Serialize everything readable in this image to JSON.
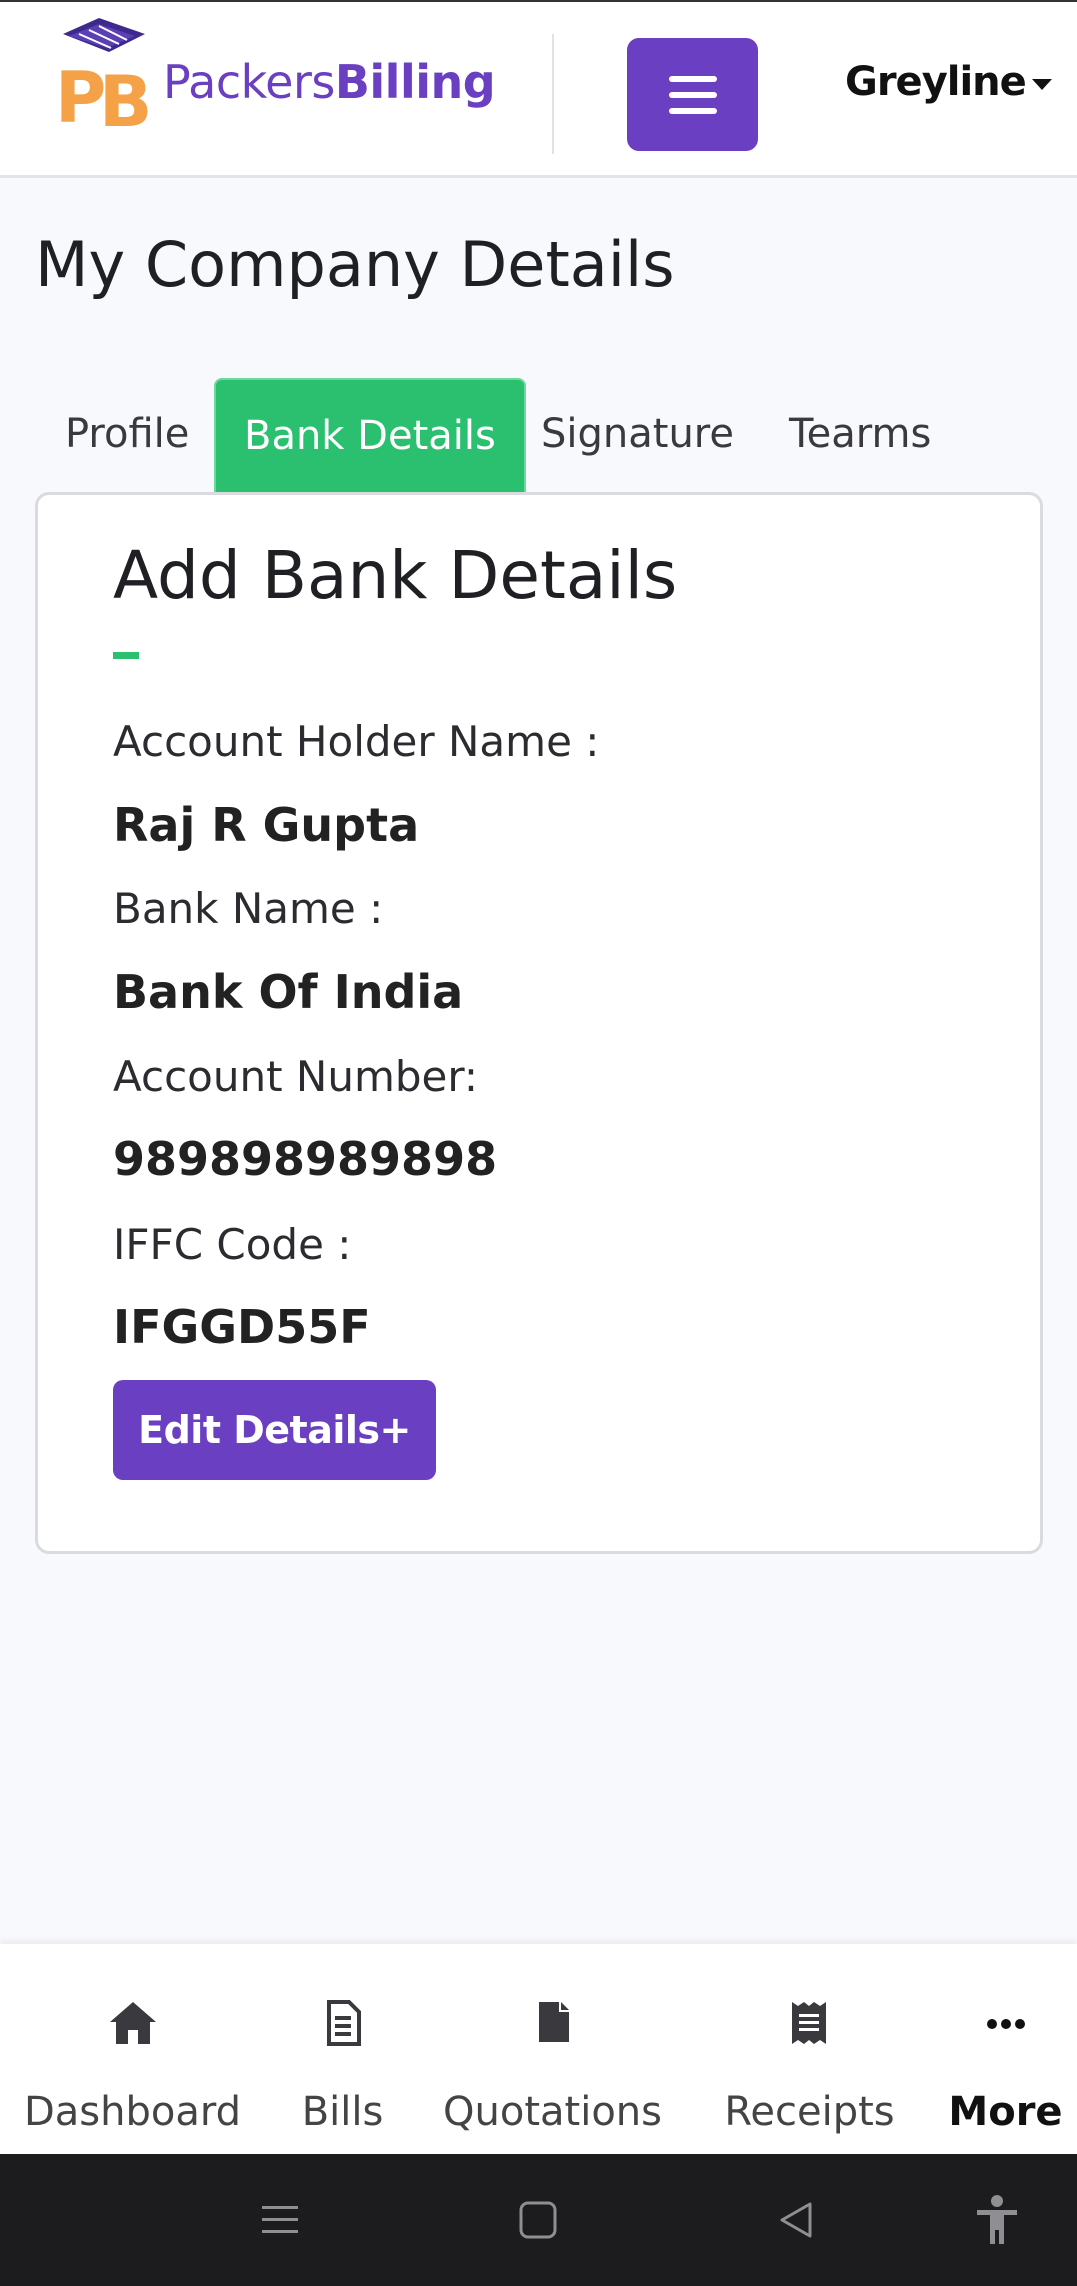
{
  "header": {
    "brand_part1": "Packers",
    "brand_part2": "Billing",
    "user_name": "Greyline"
  },
  "page": {
    "title": "My Company Details"
  },
  "tabs": [
    {
      "label": "Profile",
      "active": false
    },
    {
      "label": "Bank Details",
      "active": true
    },
    {
      "label": "Signature",
      "active": false
    },
    {
      "label": "Tearms",
      "active": false
    }
  ],
  "bank_card": {
    "title": "Add Bank Details",
    "fields": [
      {
        "label": "Account Holder Name :",
        "value": "Raj R Gupta"
      },
      {
        "label": "Bank Name :",
        "value": "Bank Of India"
      },
      {
        "label": "Account Number:",
        "value": "989898989898"
      },
      {
        "label": "IFFC Code :",
        "value": "IFGGD55F"
      }
    ],
    "edit_button": "Edit Details+"
  },
  "bottom_nav": [
    {
      "label": "Dashboard",
      "icon": "home-icon"
    },
    {
      "label": "Bills",
      "icon": "bill-icon"
    },
    {
      "label": "Quotations",
      "icon": "document-icon"
    },
    {
      "label": "Receipts",
      "icon": "receipt-icon"
    },
    {
      "label": "More",
      "icon": "more-dots-icon"
    }
  ],
  "colors": {
    "brand_purple": "#6a3fc2",
    "active_tab_green": "#2bc06f",
    "logo_orange": "#f5a147"
  }
}
